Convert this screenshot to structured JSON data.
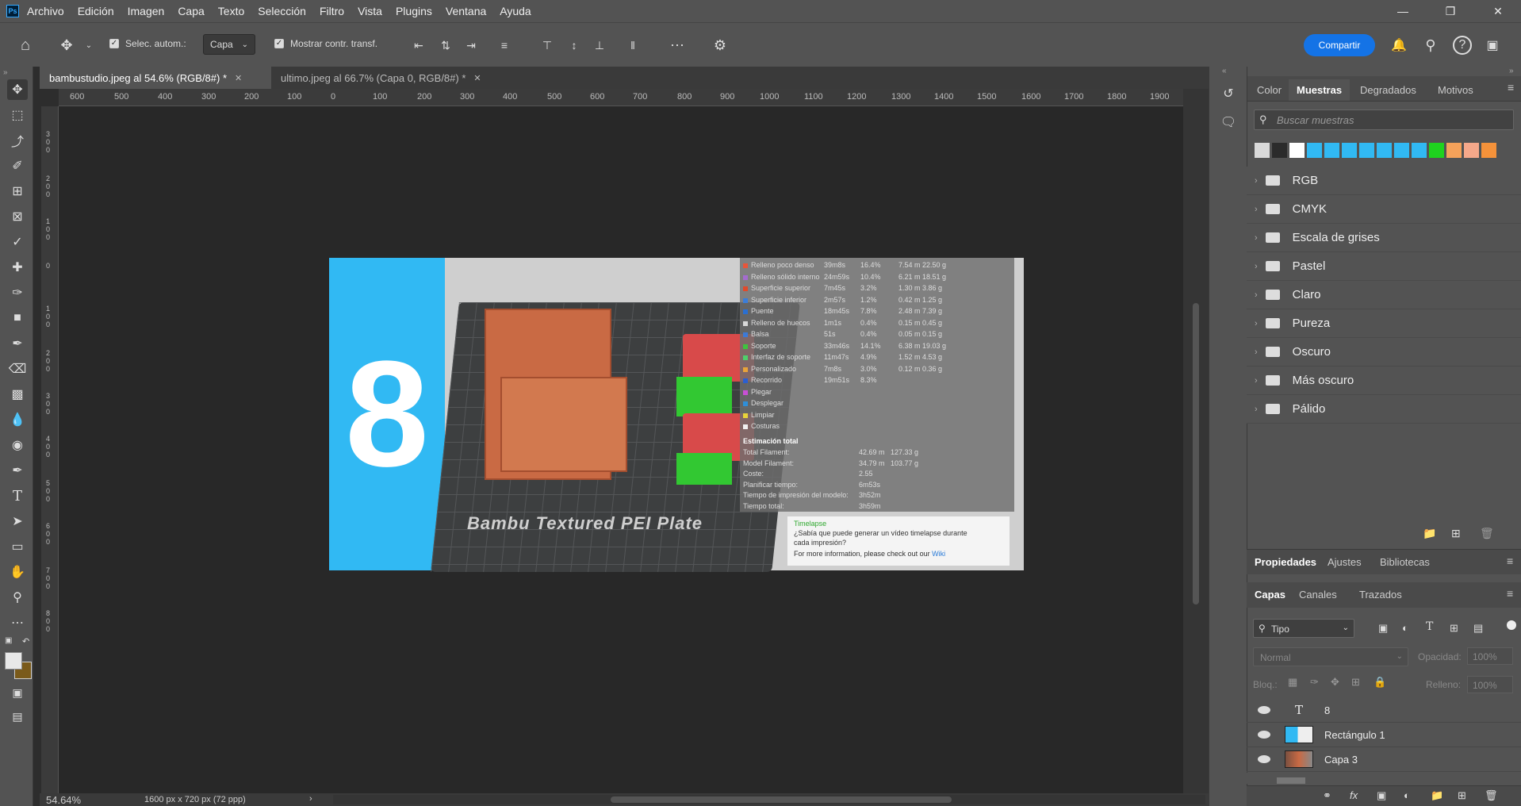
{
  "menu": {
    "logo": "Ps",
    "items": [
      "Archivo",
      "Edición",
      "Imagen",
      "Capa",
      "Texto",
      "Selección",
      "Filtro",
      "Vista",
      "Plugins",
      "Ventana",
      "Ayuda"
    ]
  },
  "options": {
    "auto_select_label": "Selec. autom.:",
    "auto_select_value": "Capa",
    "show_transform_label": "Mostrar contr. transf.",
    "share_button": "Compartir"
  },
  "tabs": [
    {
      "label": "bambustudio.jpeg al 54.6% (RGB/8#) *",
      "active": true
    },
    {
      "label": "ultimo.jpeg al 66.7% (Capa 0, RGB/8#) *",
      "active": false
    }
  ],
  "ruler_top": [
    "600",
    "500",
    "400",
    "300",
    "200",
    "100",
    "0",
    "100",
    "200",
    "300",
    "400",
    "500",
    "600",
    "700",
    "800",
    "900",
    "1000",
    "1100",
    "1200",
    "1300",
    "1400",
    "1500",
    "1600",
    "1700",
    "1800",
    "1900"
  ],
  "ruler_left": [
    "3 0 0",
    "2 0 0",
    "1 0 0",
    "0",
    "1 0 0",
    "2 0 0",
    "3 0 0",
    "4 0 0",
    "5 0 0",
    "6 0 0",
    "7 0 0",
    "8 0 0"
  ],
  "document": {
    "number_text": "8",
    "plate_text": "Bambu Textured PEI Plate",
    "stats_rows": [
      [
        "Relleno poco denso",
        "39m8s",
        "16.4%",
        "7.54 m  22.50 g"
      ],
      [
        "Relleno sólido interno",
        "24m59s",
        "10.4%",
        "6.21 m  18.51 g"
      ],
      [
        "Superficie superior",
        "7m45s",
        "3.2%",
        "1.30 m  3.86 g"
      ],
      [
        "Superficie inferior",
        "2m57s",
        "1.2%",
        "0.42 m  1.25 g"
      ],
      [
        "Puente",
        "18m45s",
        "7.8%",
        "2.48 m  7.39 g"
      ],
      [
        "Relleno de huecos",
        "1m1s",
        "0.4%",
        "0.15 m  0.45 g"
      ],
      [
        "Balsa",
        "51s",
        "0.4%",
        "0.05 m  0.15 g"
      ],
      [
        "Soporte",
        "33m46s",
        "14.1%",
        "6.38 m  19.03 g"
      ],
      [
        "Interfaz de soporte",
        "11m47s",
        "4.9%",
        "1.52 m  4.53 g"
      ],
      [
        "Personalizado",
        "7m8s",
        "3.0%",
        "0.12 m  0.36 g"
      ],
      [
        "Recorrido",
        "19m51s",
        "8.3%",
        ""
      ],
      [
        "Plegar",
        "",
        "",
        ""
      ],
      [
        "Desplegar",
        "",
        "",
        ""
      ],
      [
        "Limpiar",
        "",
        "",
        ""
      ],
      [
        "Costuras",
        "",
        "",
        ""
      ]
    ],
    "stats_colors": [
      "#e8553a",
      "#a46ccf",
      "#e04a2b",
      "#3b7dd8",
      "#2a6fd1",
      "#d8d8d8",
      "#3d7ad6",
      "#3ec43e",
      "#4fcf6b",
      "#e8a33a",
      "#2b5fd0",
      "#c94fd6",
      "#2f8fd8",
      "#e8d43a",
      "#f0f0f0"
    ],
    "summary_title": "Estimación total",
    "summary_rows": [
      [
        "Total Filament:",
        "42.69 m",
        "127.33 g"
      ],
      [
        "Model Filament:",
        "34.79 m",
        "103.77 g"
      ],
      [
        "Coste:",
        "2.55",
        ""
      ],
      [
        "Planificar tiempo:",
        "6m53s",
        ""
      ],
      [
        "Tiempo de impresión del modelo:",
        "3h52m",
        ""
      ],
      [
        "Tiempo total:",
        "3h59m",
        ""
      ]
    ],
    "timelapse_title": "Timelapse",
    "timelapse_line1": "¿Sabía que puede generar un vídeo timelapse durante",
    "timelapse_line2": "cada impresión?",
    "timelapse_line3": "For more information, please check out our",
    "timelapse_link": "Wiki"
  },
  "status": {
    "zoom": "54.64%",
    "doc_info": "1600 px x 720 px (72 ppp)"
  },
  "swatches_panel": {
    "tabs": [
      "Color",
      "Muestras",
      "Degradados",
      "Motivos"
    ],
    "active_tab": "Muestras",
    "search_placeholder": "Buscar muestras",
    "swatch_colors": [
      "#d9d9d9",
      "#2b2b2b",
      "#ffffff",
      "#31b9f3",
      "#31b9f3",
      "#31b9f3",
      "#31b9f3",
      "#31b9f3",
      "#31b9f3",
      "#31b9f3",
      "#1fd21f",
      "#f5a25a",
      "#f5a88a",
      "#f5923a"
    ],
    "groups": [
      "RGB",
      "CMYK",
      "Escala de grises",
      "Pastel",
      "Claro",
      "Pureza",
      "Oscuro",
      "Más oscuro",
      "Pálido"
    ]
  },
  "properties_tabs": [
    "Propiedades",
    "Ajustes",
    "Bibliotecas"
  ],
  "layers_panel": {
    "tabs": [
      "Capas",
      "Canales",
      "Trazados"
    ],
    "filter_label": "Tipo",
    "blend_mode": "Normal",
    "opacity_label": "Opacidad:",
    "opacity_value": "100%",
    "lock_label": "Bloq.:",
    "fill_label": "Relleno:",
    "fill_value": "100%",
    "layers": [
      "8",
      "Rectángulo 1",
      "Capa 3"
    ]
  }
}
